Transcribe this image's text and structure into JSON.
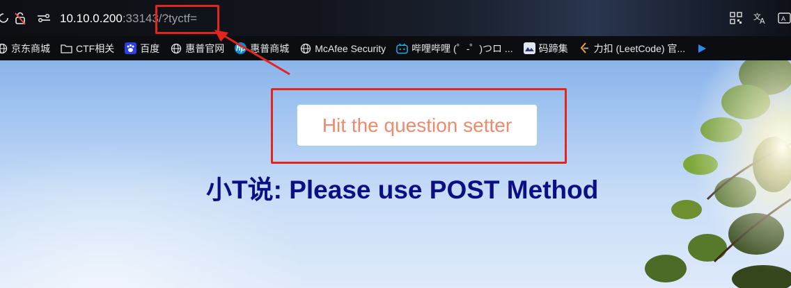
{
  "address_bar": {
    "url_host": "10.10.0.200",
    "url_rest": ":33143/?tyctf="
  },
  "bookmarks": [
    {
      "label": "京东商城",
      "icon": "globe-icon"
    },
    {
      "label": "CTF相关",
      "icon": "folder-icon"
    },
    {
      "label": "百度",
      "icon": "baidu-icon"
    },
    {
      "label": "惠普官网",
      "icon": "globe-icon"
    },
    {
      "label": "惠普商城",
      "icon": "hp-icon"
    },
    {
      "label": "McAfee Security",
      "icon": "globe-icon"
    },
    {
      "label": "哔哩哔哩 (゜-゜)つロ ...",
      "icon": "bilibili-icon"
    },
    {
      "label": "码蹄集",
      "icon": "matiji-icon"
    },
    {
      "label": "力扣 (LeetCode) 官...",
      "icon": "leetcode-icon"
    }
  ],
  "page": {
    "button_label": "Hit the question setter",
    "headline": "小T说: Please use POST Method"
  },
  "colors": {
    "annotation": "#e3251c",
    "button_text": "#ee8a6d",
    "headline": "#0b0f86"
  }
}
